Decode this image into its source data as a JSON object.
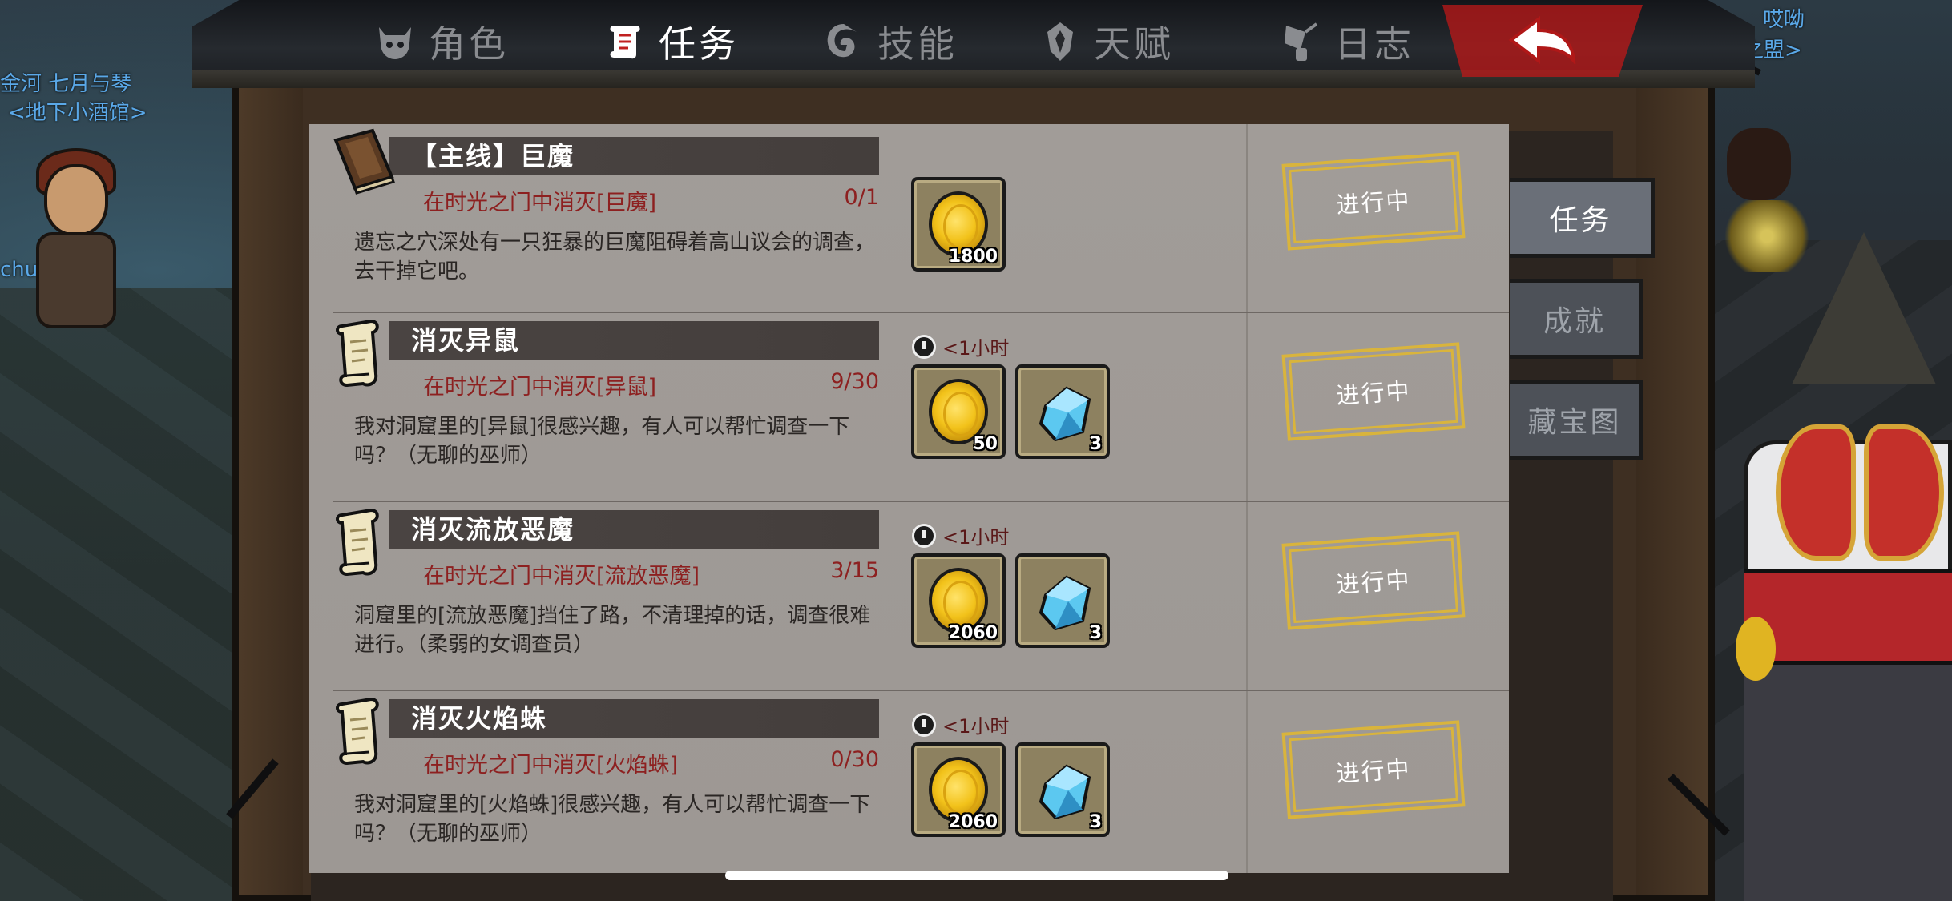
{
  "colors": {
    "active_tab_red": "#d92a2a",
    "objective_red": "#8d2020",
    "status_gold": "#d9b43c",
    "panel_bg": "#a19c98"
  },
  "world_text": {
    "left_top": "金河  七月与琴",
    "left_sub": "<地下小酒馆>",
    "left_name": "chuchu",
    "right_top": "哎呦",
    "right_sub": "之盟>"
  },
  "tabs": [
    {
      "label": "角色",
      "icon": "demon-mask-icon",
      "active": false
    },
    {
      "label": "任务",
      "icon": "scroll-icon",
      "active": true
    },
    {
      "label": "技能",
      "icon": "skill-swirl-icon",
      "active": false
    },
    {
      "label": "天赋",
      "icon": "talent-crest-icon",
      "active": false
    },
    {
      "label": "日志",
      "icon": "journal-feather-icon",
      "active": false
    }
  ],
  "back_icon": "back-arrow-icon",
  "side_tabs": [
    {
      "label": "任务",
      "active": true
    },
    {
      "label": "成就",
      "active": false
    },
    {
      "label": "藏宝图",
      "active": false
    }
  ],
  "quests": [
    {
      "title": "【主线】巨魔",
      "icon": "book-icon",
      "objective": "在时光之门中消灭[巨魔]",
      "progress": "0/1",
      "description": "遗忘之穴深处有一只狂暴的巨魔阻碍着高山议会的调查，去干掉它吧。",
      "timer": "",
      "rewards": [
        {
          "type": "gold-coin-icon",
          "qty": "1800"
        }
      ],
      "status": "进行中"
    },
    {
      "title": "消灭异鼠",
      "icon": "scroll-quest-icon",
      "objective": "在时光之门中消灭[异鼠]",
      "progress": "9/30",
      "description": "我对洞窟里的[异鼠]很感兴趣，有人可以帮忙调查一下吗？（无聊的巫师）",
      "timer": "<1小时",
      "rewards": [
        {
          "type": "gold-coin-icon",
          "qty": "50"
        },
        {
          "type": "blue-gem-icon",
          "qty": "3"
        }
      ],
      "status": "进行中"
    },
    {
      "title": "消灭流放恶魔",
      "icon": "scroll-quest-icon",
      "objective": "在时光之门中消灭[流放恶魔]",
      "progress": "3/15",
      "description": "洞窟里的[流放恶魔]挡住了路，不清理掉的话，调查很难进行。（柔弱的女调查员）",
      "timer": "<1小时",
      "rewards": [
        {
          "type": "gold-coin-icon",
          "qty": "2060"
        },
        {
          "type": "blue-gem-icon",
          "qty": "3"
        }
      ],
      "status": "进行中"
    },
    {
      "title": "消灭火焰蛛",
      "icon": "scroll-quest-icon",
      "objective": "在时光之门中消灭[火焰蛛]",
      "progress": "0/30",
      "description": "我对洞窟里的[火焰蛛]很感兴趣，有人可以帮忙调查一下吗？（无聊的巫师）",
      "timer": "<1小时",
      "rewards": [
        {
          "type": "gold-coin-icon",
          "qty": "2060"
        },
        {
          "type": "blue-gem-icon",
          "qty": "3"
        }
      ],
      "status": "进行中"
    }
  ]
}
